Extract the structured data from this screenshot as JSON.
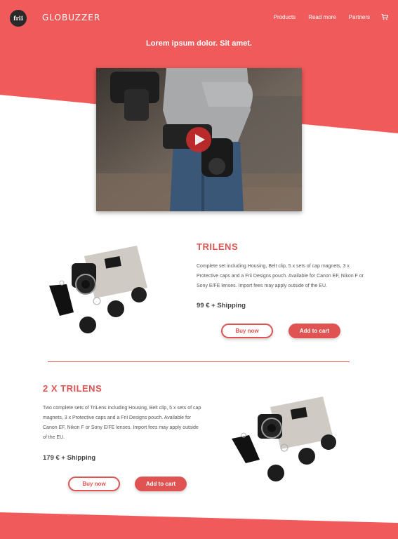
{
  "header": {
    "logo_text": "frii",
    "brand": "GLOBUZZER",
    "nav": [
      "Products",
      "Read more",
      "Partners"
    ]
  },
  "hero": {
    "title": "Lorem ipsum dolor. Sit amet."
  },
  "colors": {
    "accent": "#f15a5a",
    "button_red": "#e05353",
    "text_dark": "#444444"
  },
  "products": [
    {
      "title": "TRILENS",
      "description": "Complete set including Housing, Belt clip, 5 x sets of cap magnets, 3 x Protective caps and a Frii Designs pouch. Available for Canon EF, Nikon F or Sony  E/FE lenses. Import fees may apply outside of the EU.",
      "price": "99 € + Shipping",
      "buy_label": "Buy now",
      "cart_label": "Add to cart"
    },
    {
      "title": "2 X TRILENS",
      "description": "Two complete sets of TriLens including Housing, Belt clip, 5 x sets of cap magnets, 3 x Protective caps and a Frii Designs pouch. Available for Canon EF, Nikon F or Sony  E/FE lenses. Import fees may apply outside of the EU.",
      "price": "179 € + Shipping",
      "buy_label": "Buy now",
      "cart_label": "Add to cart"
    }
  ],
  "icons": [
    "cart-icon",
    "play-icon"
  ]
}
